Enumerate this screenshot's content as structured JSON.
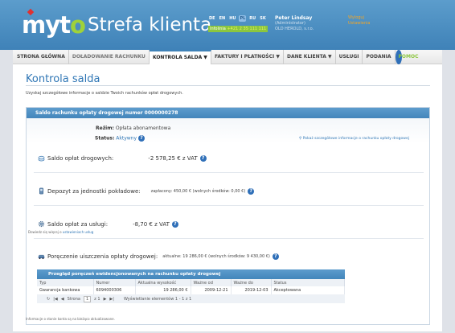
{
  "header": {
    "logo_text_prefix": "my",
    "logo_text_o": "t",
    "logo_text_suffix": "o",
    "app_title": "Strefa klienta",
    "languages": [
      {
        "code": "DE",
        "active": false
      },
      {
        "code": "EN",
        "active": false
      },
      {
        "code": "HU",
        "active": false
      },
      {
        "code": "PL",
        "active": true
      },
      {
        "code": "RU",
        "active": false
      },
      {
        "code": "SK",
        "active": false
      }
    ],
    "hotline_label": "Infolinia",
    "hotline_number": "+421 2 35 111 111",
    "user_name": "Peter Lindsay",
    "user_role": "(Administrator)",
    "user_company": "OLD HEROLD, s.r.o.",
    "logout_label": "Wyloguj",
    "settings_label": "Ustawienia"
  },
  "nav": {
    "items": [
      {
        "label": "STRONA GŁÓWNA",
        "state": "normal"
      },
      {
        "label": "DOŁADOWANIE RACHUNKU",
        "state": "muted"
      },
      {
        "label": "KONTROLA SALDA ▼",
        "state": "active"
      },
      {
        "label": "FAKTURY I PŁATNOŚCI ▼",
        "state": "normal"
      },
      {
        "label": "DANE KLIENTA ▼",
        "state": "normal"
      },
      {
        "label": "USŁUGI",
        "state": "normal"
      },
      {
        "label": "PODANIA",
        "state": "normal"
      },
      {
        "label": "POMOC",
        "state": "help"
      }
    ]
  },
  "page": {
    "title": "Kontrola salda",
    "intro": "Uzyskaj szczegółowe informacje o saldzie Twoich rachunków opłat drogowych."
  },
  "account": {
    "header": "Saldo rachunku opłaty drogowej numer 0000000278",
    "regime_label": "Reżim:",
    "regime_value": "Opłata abonamentowa",
    "status_label": "Status:",
    "status_value": "Aktywny",
    "details_link": "Pokaż szczegółowe informacje o rachunku opłaty drogowej",
    "toll_balance_label": "Saldo opłat drogowych:",
    "toll_balance_value": "-2 578,25 € z VAT",
    "deposit_label": "Depozyt za jednostki pokładowe:",
    "deposit_value": "zapłacony: 450,00 € (wolnych środków: 0,00 €)",
    "service_label": "Saldo opłat za usługi:",
    "service_value": "-8,70 € z VAT",
    "service_more_prefix": "Dowiedz się więcej o",
    "service_more_link": "ustawieniach usług",
    "guarantee_label": "Poręczenie uiszczenia opłaty drogowej:",
    "guarantee_value": "aktualne: 19 286,00 € (wolnych środków: 9 430,00 €)"
  },
  "guarantees_table": {
    "title": "Przegląd poręczeń ewidencjonowanych na rachunku opłaty drogowej",
    "columns": [
      "Typ",
      "Numer",
      "Aktualna wysokość",
      "Ważne od",
      "Ważne do",
      "Status"
    ],
    "rows": [
      [
        "Gwarancja bankowa",
        "6094000306",
        "19 286,00 €",
        "2009-12-21",
        "2019-12-03",
        "Akceptowana"
      ]
    ],
    "pager_page_label": "Strona",
    "pager_page": "1",
    "pager_of": "z 1",
    "pager_info": "Wyświetlanie elementów 1 - 1 z 1"
  },
  "footnote": "Informacje o stanie konta są na bieżąco aktualizowane."
}
